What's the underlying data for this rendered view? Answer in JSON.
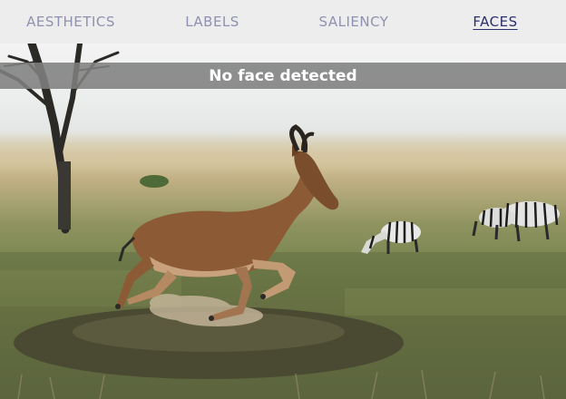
{
  "tabs": [
    {
      "label": "AESTHETICS",
      "active": false
    },
    {
      "label": "LABELS",
      "active": false
    },
    {
      "label": "SALIENCY",
      "active": false
    },
    {
      "label": "FACES",
      "active": true
    }
  ],
  "status": {
    "message": "No face detected"
  },
  "colors": {
    "tab_inactive": "#8e92b0",
    "tab_active": "#2b2f6b",
    "tab_bar_bg": "#ededed",
    "banner_bg": "#808080"
  }
}
